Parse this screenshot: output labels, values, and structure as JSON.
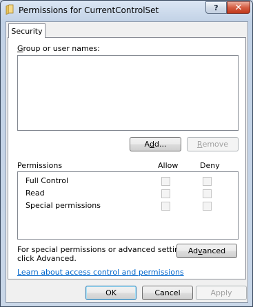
{
  "window": {
    "title": "Permissions for CurrentControlSet",
    "help_glyph": "?",
    "close_glyph": "✕",
    "icons": {
      "folder": "folder-icon",
      "help": "help-icon",
      "close": "close-icon"
    }
  },
  "tab": {
    "label": "Security"
  },
  "group_section": {
    "label_hotkey": "G",
    "label_rest": "roup or user names:",
    "add_prefix": "A",
    "add_hotkey": "d",
    "add_suffix": "d...",
    "remove_hotkey": "R",
    "remove_rest": "emove"
  },
  "permissions": {
    "header": "Permissions",
    "allow_header": "Allow",
    "deny_header": "Deny",
    "rows": [
      {
        "label": "Full Control",
        "allow": false,
        "deny": false
      },
      {
        "label": "Read",
        "allow": false,
        "deny": false
      },
      {
        "label": "Special permissions",
        "allow": false,
        "deny": false
      }
    ]
  },
  "advanced": {
    "text_line1": "For special permissions or advanced settings,",
    "text_line2": "click Advanced.",
    "button_prefix": "Ad",
    "button_hotkey": "v",
    "button_suffix": "anced"
  },
  "link": {
    "label": "Learn about access control and permissions"
  },
  "footer": {
    "ok": "OK",
    "cancel": "Cancel",
    "apply": "Apply"
  },
  "colors": {
    "link": "#0066cc",
    "close_button": "#c0391c",
    "disabled_text": "#a0a0a0"
  }
}
